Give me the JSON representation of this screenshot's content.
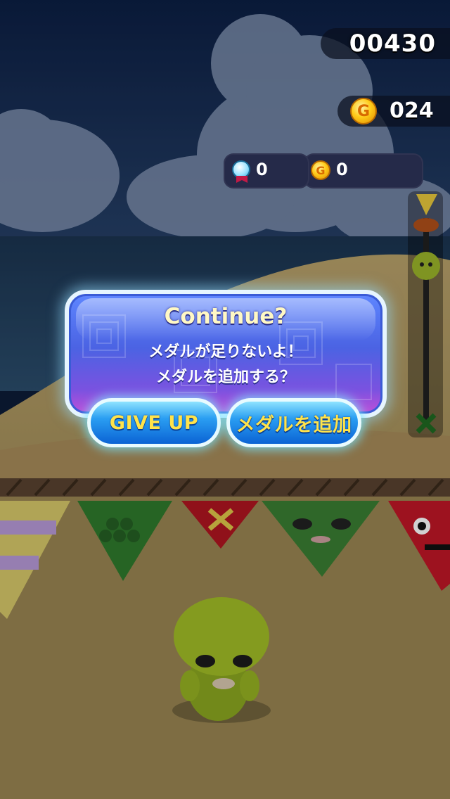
{
  "hud": {
    "score": "00430",
    "coins": "024",
    "medals_count": "0",
    "bonus_coins_count": "0"
  },
  "dialog": {
    "title": "Continue?",
    "line1": "メダルが足りないよ！",
    "line2": "メダルを追加する？"
  },
  "buttons": {
    "give_up": "GIVE UP",
    "add_medal": "メダルを追加"
  },
  "colors": {
    "dialog_blue": "#4b63e3",
    "button_text": "#ffe34a",
    "title_text": "#fff8c4"
  },
  "icons": [
    "coin-icon",
    "medal-icon",
    "progress-flag-icon",
    "player-marker-icon",
    "goal-x-icon"
  ]
}
